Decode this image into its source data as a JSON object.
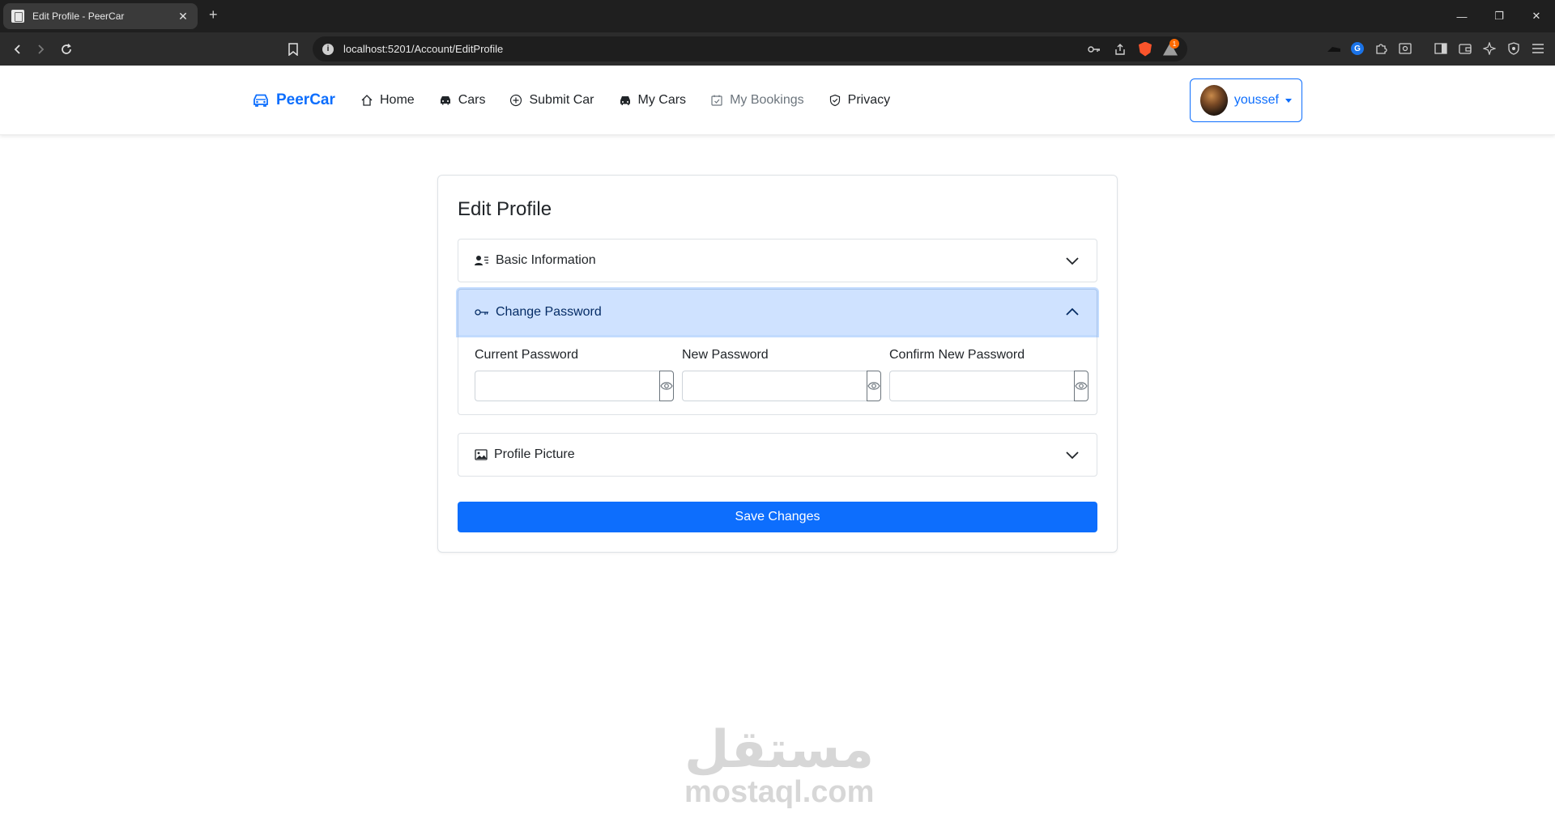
{
  "browser": {
    "tab_title": "Edit Profile - PeerCar",
    "tab_close": "✕",
    "new_tab": "+",
    "url": "localhost:5201/Account/EditProfile",
    "notification_count": "1",
    "window_minimize": "—",
    "window_restore": "❐",
    "window_close": "✕"
  },
  "navbar": {
    "brand": "PeerCar",
    "links": [
      {
        "label": "Home",
        "icon": "house-icon"
      },
      {
        "label": "Cars",
        "icon": "car-icon"
      },
      {
        "label": "Submit Car",
        "icon": "plus-circle-icon"
      },
      {
        "label": "My Cars",
        "icon": "car-front-icon"
      },
      {
        "label": "My Bookings",
        "icon": "calendar-check-icon"
      },
      {
        "label": "Privacy",
        "icon": "shield-check-icon"
      }
    ],
    "user": "youssef"
  },
  "card": {
    "title": "Edit Profile",
    "sections": {
      "basic": "Basic Information",
      "password": "Change Password",
      "picture": "Profile Picture"
    },
    "fields": {
      "current": {
        "label": "Current Password",
        "value": ""
      },
      "new": {
        "label": "New Password",
        "value": ""
      },
      "confirm": {
        "label": "Confirm New Password",
        "value": ""
      }
    },
    "save_label": "Save Changes"
  },
  "watermark": {
    "arabic": "مستقل",
    "latin": "mostaql.com"
  },
  "colors": {
    "primary": "#0d6efd",
    "accordion_active_bg": "#cfe2ff",
    "chrome_dark": "#1f1f1f"
  }
}
